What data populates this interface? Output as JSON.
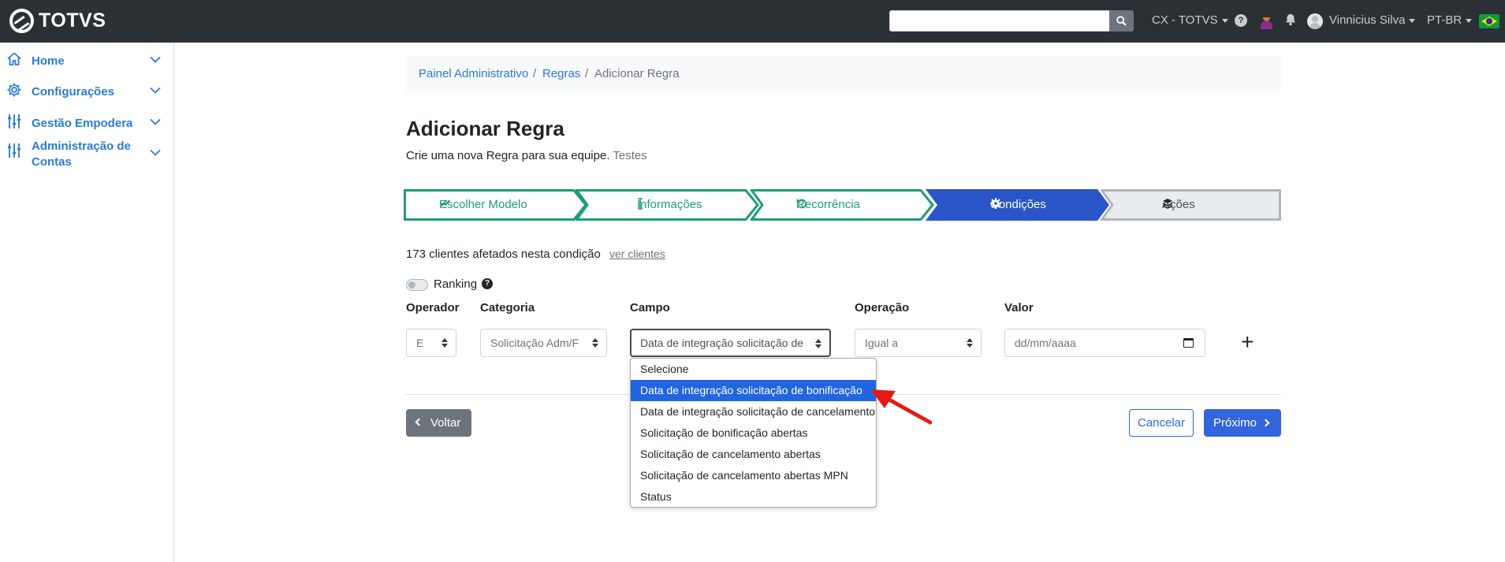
{
  "topbar": {
    "brand": "TOTVS",
    "search_value": "",
    "org_menu": "CX - TOTVS",
    "help": "?",
    "user_name": "Vinnicius Silva",
    "language": "PT-BR"
  },
  "sidebar": {
    "items": [
      {
        "label": "Home",
        "icon": "home-icon"
      },
      {
        "label": "Configurações",
        "icon": "gear-icon"
      },
      {
        "label": "Gestão Empodera",
        "icon": "sliders-icon"
      },
      {
        "label": "Administração de Contas",
        "label_line1": "Administração de",
        "label_line2": "Contas",
        "icon": "sliders-icon"
      }
    ],
    "accent": "#2a7bd6"
  },
  "breadcrumb": {
    "items": [
      "Painel Administrativo",
      "Regras",
      "Adicionar Regra"
    ],
    "separator": "/"
  },
  "page": {
    "title": "Adicionar Regra",
    "subtitle": "Crie uma nova Regra para sua equipe.",
    "subtitle_team": "Testes"
  },
  "stepper": {
    "steps": [
      {
        "label": "Escolher Modelo",
        "icon": "double-check-icon",
        "state": "done"
      },
      {
        "label": "Informações",
        "icon": "text-cursor-icon",
        "state": "done"
      },
      {
        "label": "Recorrência",
        "icon": "undo-icon",
        "state": "done"
      },
      {
        "label": "Condições",
        "icon": "gear-icon",
        "state": "active"
      },
      {
        "label": "Ações",
        "icon": "layers-icon",
        "state": "pending"
      }
    ],
    "colors": {
      "done": "#1f9d7a",
      "active": "#2a55c9",
      "pending": "#e9ecef"
    }
  },
  "conditions": {
    "affected_text": "173 clientes afetados nesta condição",
    "see_clients": "ver clientes",
    "ranking_label": "Ranking",
    "ranking_on": false,
    "help": "?",
    "columns": {
      "operator": "Operador",
      "category": "Categoria",
      "field": "Campo",
      "operation": "Operação",
      "value": "Valor"
    },
    "row": {
      "operator": "E",
      "category": "Solicitação Adm/F",
      "field": "Data de integração solicitação de",
      "operation": "Igual a",
      "value_placeholder": "dd/mm/aaaa"
    },
    "add": "+"
  },
  "field_dropdown": {
    "options": [
      "Selecione",
      "Data de integração solicitação de bonificação",
      "Data de integração solicitação de cancelamento",
      "Solicitação de bonificação abertas",
      "Solicitação de cancelamento abertas",
      "Solicitação de cancelamento abertas MPN",
      "Status"
    ],
    "selected_index": 1
  },
  "actions": {
    "back": "Voltar",
    "cancel": "Cancelar",
    "next": "Próximo"
  }
}
